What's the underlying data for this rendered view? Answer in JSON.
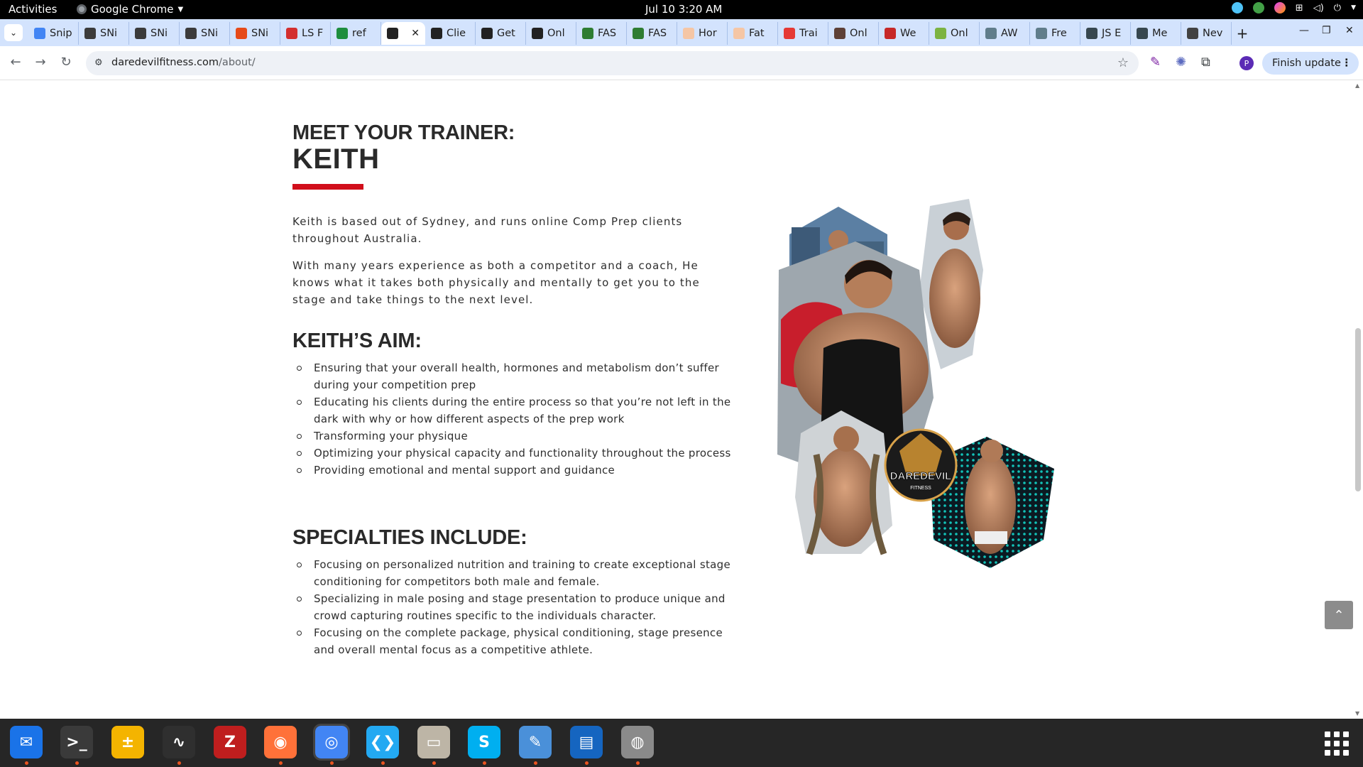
{
  "system": {
    "activities": "Activities",
    "app_name": "Google Chrome",
    "clock": "Jul 10  3:20 AM"
  },
  "tabs": [
    {
      "label": "Snip",
      "color": "#4285f4",
      "icon": "docs-icon"
    },
    {
      "label": "SNi",
      "color": "#3b3b3b",
      "icon": "snip-icon"
    },
    {
      "label": "SNi",
      "color": "#3b3b3b",
      "icon": "snip-icon"
    },
    {
      "label": "SNi",
      "color": "#3b3b3b",
      "icon": "snip-icon"
    },
    {
      "label": "SNi",
      "color": "#e64a19",
      "icon": "orange-icon"
    },
    {
      "label": "LS F",
      "color": "#d32f2f",
      "icon": "ls-icon"
    },
    {
      "label": "ref",
      "color": "#1e8e3e",
      "icon": "sheets-icon"
    },
    {
      "label": "",
      "color": "#222222",
      "icon": "daredevil-icon",
      "active": true
    },
    {
      "label": "Clie",
      "color": "#222222",
      "icon": "daredevil-icon"
    },
    {
      "label": "Get",
      "color": "#222222",
      "icon": "daredevil-icon"
    },
    {
      "label": "Onl",
      "color": "#222222",
      "icon": "daredevil-icon"
    },
    {
      "label": "FAS",
      "color": "#2e7d32",
      "icon": "fas-icon"
    },
    {
      "label": "FAS",
      "color": "#2e7d32",
      "icon": "fas-icon"
    },
    {
      "label": "Hor",
      "color": "#f5c6a5",
      "icon": "hand-icon"
    },
    {
      "label": "Fat",
      "color": "#f5c6a5",
      "icon": "hand-icon"
    },
    {
      "label": "Trai",
      "color": "#e53935",
      "icon": "heart-icon"
    },
    {
      "label": "Onl",
      "color": "#5d4037",
      "icon": "person-icon"
    },
    {
      "label": "We",
      "color": "#c62828",
      "icon": "person-icon"
    },
    {
      "label": "Onl",
      "color": "#7cb342",
      "icon": "image-icon"
    },
    {
      "label": "AW",
      "color": "#607d8b",
      "icon": "mountain-icon"
    },
    {
      "label": "Fre",
      "color": "#607d8b",
      "icon": "mountain-icon"
    },
    {
      "label": "JS E",
      "color": "#37474f",
      "icon": "shield-icon"
    },
    {
      "label": "Me",
      "color": "#37474f",
      "icon": "shield-icon"
    },
    {
      "label": "Nev",
      "color": "#424242",
      "icon": "globe-icon"
    }
  ],
  "toolbar": {
    "url_domain": "daredevilfitness.com",
    "url_path": "/about/",
    "finish_update": "Finish update",
    "profile_initial": "P"
  },
  "page": {
    "meet_label": "MEET YOUR TRAINER:",
    "trainer_name": "KEITH",
    "intro_1": "Keith is based out of Sydney, and runs online Comp Prep clients throughout Australia.",
    "intro_2": "With many years experience as both a competitor and a coach, He knows what it takes both physically and mentally to get you to the stage and take things to the next level.",
    "aim_heading": "KEITH’S AIM:",
    "aim_items": [
      "Ensuring that your overall health, hormones and metabolism don’t suffer during your competition prep",
      "Educating his clients during the entire process so that you’re not left in the dark with why or how different aspects of the prep work",
      "Transforming your physique",
      "Optimizing your physical capacity and functionality throughout the process",
      "Providing emotional and mental support and guidance"
    ],
    "specialties_heading": "SPECIALTIES INCLUDE:",
    "specialties_items": [
      "Focusing on personalized nutrition and training to create exceptional stage conditioning for competitors both male and female.",
      "Specializing in male posing and stage presentation to produce unique and crowd capturing routines specific to the individuals character.",
      "Focusing on the complete package, physical conditioning, stage presence and overall mental focus as a competitive athlete."
    ],
    "logo_text": "DAREDEVIL",
    "logo_subtext": "FITNESS",
    "accent_color": "#d10f1b"
  },
  "dock": [
    {
      "name": "thunderbird-icon",
      "color": "#1a73e8",
      "glyph": "✉",
      "running": true
    },
    {
      "name": "terminal-icon",
      "color": "#3a3a3a",
      "glyph": ">_",
      "running": true
    },
    {
      "name": "calculator-icon",
      "color": "#f4b400",
      "glyph": "±",
      "running": false
    },
    {
      "name": "system-monitor-icon",
      "color": "#2f2f2f",
      "glyph": "∿",
      "running": true
    },
    {
      "name": "filezilla-icon",
      "color": "#bf1e1e",
      "glyph": "Z",
      "running": false
    },
    {
      "name": "firefox-icon",
      "color": "#ff7139",
      "glyph": "◉",
      "running": true
    },
    {
      "name": "chrome-icon",
      "color": "#4285f4",
      "glyph": "◎",
      "running": true
    },
    {
      "name": "vscode-icon",
      "color": "#23a9f2",
      "glyph": "❮❯",
      "running": true
    },
    {
      "name": "files-icon",
      "color": "#bdb5a6",
      "glyph": "▭",
      "running": true
    },
    {
      "name": "skype-icon",
      "color": "#00aff0",
      "glyph": "S",
      "running": true
    },
    {
      "name": "text-editor-icon",
      "color": "#4a90d9",
      "glyph": "✎",
      "running": true
    },
    {
      "name": "writer-icon",
      "color": "#1565c0",
      "glyph": "▤",
      "running": true
    },
    {
      "name": "disk-icon",
      "color": "#8a8a8a",
      "glyph": "◍",
      "running": true
    }
  ]
}
